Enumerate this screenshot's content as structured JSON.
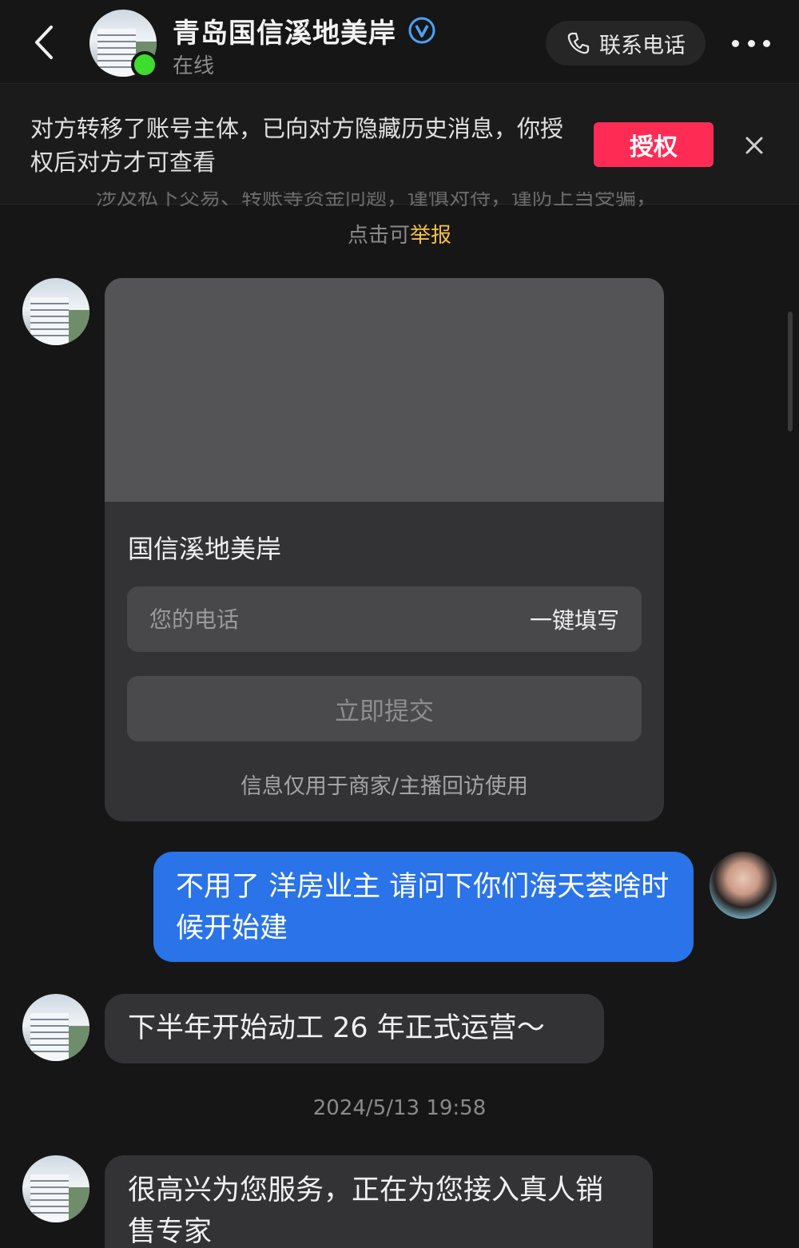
{
  "header": {
    "title": "青岛国信溪地美岸",
    "status": "在线",
    "call_label": "联系电话"
  },
  "notice": {
    "text": "对方转移了账号主体，已向对方隐藏历史消息，你授权后对方才可查看",
    "authorize_label": "授权"
  },
  "safety_tip": {
    "partial_text": "涉及私下交易、转账等资金问题，谨慎对待，谨防上当受骗，",
    "report_prefix": "点击可",
    "report_link": "举报"
  },
  "form_card": {
    "title": "国信溪地美岸",
    "phone_placeholder": "您的电话",
    "autofill_label": "一键填写",
    "submit_label": "立即提交",
    "footnote": "信息仅用于商家/主播回访使用"
  },
  "messages": [
    {
      "sender": "me",
      "text": "不用了 洋房业主  请问下你们海天荟啥时候开始建"
    },
    {
      "sender": "them",
      "text": "下半年开始动工 26 年正式运营～"
    },
    {
      "sender": "them",
      "text": "很高兴为您服务，正在为您接入真人销售专家"
    }
  ],
  "timestamp": "2024/5/13 19:58",
  "colors": {
    "background": "#161616",
    "accent_red": "#fe2c55",
    "my_bubble": "#2a73e8",
    "their_bubble": "#333336",
    "online": "#3ddc2e",
    "report_link": "#f5c242"
  }
}
